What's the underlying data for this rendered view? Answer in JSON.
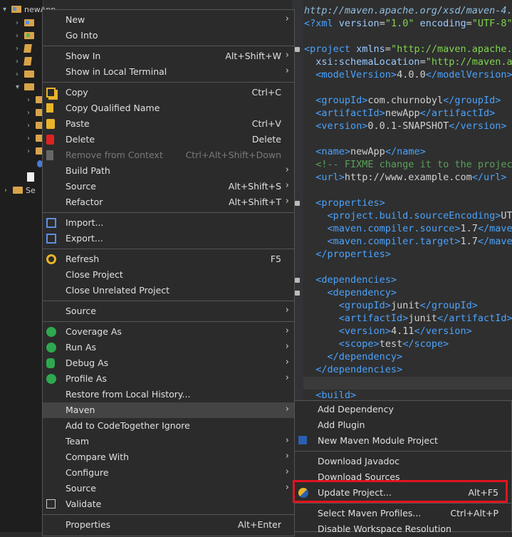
{
  "explorer": {
    "project_label": "newApp",
    "servers_label": "Se"
  },
  "editor": {
    "lines": [
      {
        "segs": [
          [
            "it",
            "http://maven.apache.org/xsd/maven-4.0"
          ]
        ]
      },
      {
        "segs": [
          [
            "tag",
            "<?xml "
          ],
          [
            "attr",
            "version"
          ],
          [
            "txt",
            "="
          ],
          [
            "str",
            "\"1.0\""
          ],
          [
            "txt",
            " "
          ],
          [
            "attr",
            "encoding"
          ],
          [
            "txt",
            "="
          ],
          [
            "str",
            "\"UTF-8\""
          ],
          [
            "tag",
            "?>"
          ]
        ]
      },
      {
        "segs": []
      },
      {
        "segs": [
          [
            "tag",
            "<project "
          ],
          [
            "attr",
            "xmlns"
          ],
          [
            "txt",
            "="
          ],
          [
            "str",
            "\"http://maven.apache.o"
          ]
        ]
      },
      {
        "segs": [
          [
            "txt",
            "  "
          ],
          [
            "attr",
            "xsi:schemaLocation"
          ],
          [
            "txt",
            "="
          ],
          [
            "str",
            "\"http://maven.ap"
          ]
        ]
      },
      {
        "segs": [
          [
            "txt",
            "  "
          ],
          [
            "tag",
            "<modelVersion>"
          ],
          [
            "txt",
            "4.0.0"
          ],
          [
            "tag",
            "</modelVersion>"
          ]
        ]
      },
      {
        "segs": []
      },
      {
        "segs": [
          [
            "txt",
            "  "
          ],
          [
            "tag",
            "<groupId>"
          ],
          [
            "txt",
            "com.churnobyl"
          ],
          [
            "tag",
            "</groupId>"
          ]
        ]
      },
      {
        "segs": [
          [
            "txt",
            "  "
          ],
          [
            "tag",
            "<artifactId>"
          ],
          [
            "txt",
            "newApp"
          ],
          [
            "tag",
            "</artifactId>"
          ]
        ]
      },
      {
        "segs": [
          [
            "txt",
            "  "
          ],
          [
            "tag",
            "<version>"
          ],
          [
            "txt",
            "0.0.1-SNAPSHOT"
          ],
          [
            "tag",
            "</version>"
          ]
        ]
      },
      {
        "segs": []
      },
      {
        "segs": [
          [
            "txt",
            "  "
          ],
          [
            "tag",
            "<name>"
          ],
          [
            "txt",
            "newApp"
          ],
          [
            "tag",
            "</name>"
          ]
        ]
      },
      {
        "segs": [
          [
            "txt",
            "  "
          ],
          [
            "cmt",
            "<!-- FIXME change it to the project"
          ]
        ]
      },
      {
        "segs": [
          [
            "txt",
            "  "
          ],
          [
            "tag",
            "<url>"
          ],
          [
            "txt",
            "http://www.example.com"
          ],
          [
            "tag",
            "</url>"
          ]
        ]
      },
      {
        "segs": []
      },
      {
        "segs": [
          [
            "txt",
            "  "
          ],
          [
            "tag",
            "<properties>"
          ]
        ]
      },
      {
        "segs": [
          [
            "txt",
            "    "
          ],
          [
            "tag",
            "<project.build.sourceEncoding>"
          ],
          [
            "txt",
            "UTF"
          ]
        ]
      },
      {
        "segs": [
          [
            "txt",
            "    "
          ],
          [
            "tag",
            "<maven.compiler.source>"
          ],
          [
            "txt",
            "1.7"
          ],
          [
            "tag",
            "</maven"
          ]
        ]
      },
      {
        "segs": [
          [
            "txt",
            "    "
          ],
          [
            "tag",
            "<maven.compiler.target>"
          ],
          [
            "txt",
            "1.7"
          ],
          [
            "tag",
            "</maven"
          ]
        ]
      },
      {
        "segs": [
          [
            "txt",
            "  "
          ],
          [
            "tag",
            "</properties>"
          ]
        ]
      },
      {
        "segs": []
      },
      {
        "segs": [
          [
            "txt",
            "  "
          ],
          [
            "tag",
            "<dependencies>"
          ]
        ]
      },
      {
        "segs": [
          [
            "txt",
            "    "
          ],
          [
            "tag",
            "<dependency>"
          ]
        ]
      },
      {
        "segs": [
          [
            "txt",
            "      "
          ],
          [
            "tag",
            "<groupId>"
          ],
          [
            "txt",
            "junit"
          ],
          [
            "tag",
            "</groupId>"
          ]
        ]
      },
      {
        "segs": [
          [
            "txt",
            "      "
          ],
          [
            "tag",
            "<artifactId>"
          ],
          [
            "txt",
            "junit"
          ],
          [
            "tag",
            "</artifactId>"
          ]
        ]
      },
      {
        "segs": [
          [
            "txt",
            "      "
          ],
          [
            "tag",
            "<version>"
          ],
          [
            "txt",
            "4.11"
          ],
          [
            "tag",
            "</version>"
          ]
        ]
      },
      {
        "segs": [
          [
            "txt",
            "      "
          ],
          [
            "tag",
            "<scope>"
          ],
          [
            "txt",
            "test"
          ],
          [
            "tag",
            "</scope>"
          ]
        ]
      },
      {
        "segs": [
          [
            "txt",
            "    "
          ],
          [
            "tag",
            "</dependency>"
          ]
        ]
      },
      {
        "segs": [
          [
            "txt",
            "  "
          ],
          [
            "tag",
            "</dependencies>"
          ]
        ]
      },
      {
        "segs": []
      },
      {
        "segs": [
          [
            "txt",
            "  "
          ],
          [
            "tag",
            "<build>"
          ]
        ]
      }
    ]
  },
  "menu": {
    "items": [
      {
        "label": "New",
        "submenu": true
      },
      {
        "label": "Go Into"
      },
      {
        "sep": true
      },
      {
        "label": "Show In",
        "shortcut": "Alt+Shift+W",
        "submenu": true
      },
      {
        "label": "Show in Local Terminal",
        "submenu": true
      },
      {
        "sep": true
      },
      {
        "label": "Copy",
        "shortcut": "Ctrl+C",
        "icon": "copy-icon"
      },
      {
        "label": "Copy Qualified Name",
        "icon": "copy-qualified-icon"
      },
      {
        "label": "Paste",
        "shortcut": "Ctrl+V",
        "icon": "paste-icon"
      },
      {
        "label": "Delete",
        "shortcut": "Delete",
        "icon": "delete-icon"
      },
      {
        "label": "Remove from Context",
        "shortcut": "Ctrl+Alt+Shift+Down",
        "icon": "remove-context-icon",
        "disabled": true
      },
      {
        "label": "Build Path",
        "submenu": true
      },
      {
        "label": "Source",
        "shortcut": "Alt+Shift+S",
        "submenu": true
      },
      {
        "label": "Refactor",
        "shortcut": "Alt+Shift+T",
        "submenu": true
      },
      {
        "sep": true
      },
      {
        "label": "Import...",
        "icon": "import-icon"
      },
      {
        "label": "Export...",
        "icon": "export-icon"
      },
      {
        "sep": true
      },
      {
        "label": "Refresh",
        "shortcut": "F5",
        "icon": "refresh-icon"
      },
      {
        "label": "Close Project"
      },
      {
        "label": "Close Unrelated Project"
      },
      {
        "sep": true
      },
      {
        "label": "Source",
        "submenu": true
      },
      {
        "sep": true
      },
      {
        "label": "Coverage As",
        "submenu": true,
        "icon": "coverage-icon"
      },
      {
        "label": "Run As",
        "submenu": true,
        "icon": "run-icon"
      },
      {
        "label": "Debug As",
        "submenu": true,
        "icon": "debug-icon"
      },
      {
        "label": "Profile As",
        "submenu": true,
        "icon": "profile-icon"
      },
      {
        "label": "Restore from Local History..."
      },
      {
        "label": "Maven",
        "submenu": true,
        "hot": true
      },
      {
        "label": "Add to CodeTogether Ignore"
      },
      {
        "label": "Team",
        "submenu": true
      },
      {
        "label": "Compare With",
        "submenu": true
      },
      {
        "label": "Configure",
        "submenu": true
      },
      {
        "label": "Source",
        "submenu": true
      },
      {
        "label": "Validate",
        "icon": "validate-icon"
      },
      {
        "sep": true
      },
      {
        "label": "Properties",
        "shortcut": "Alt+Enter"
      }
    ]
  },
  "maven_submenu": {
    "items": [
      {
        "label": "Add Dependency"
      },
      {
        "label": "Add Plugin"
      },
      {
        "label": "New Maven Module Project",
        "icon": "maven-module-icon"
      },
      {
        "sep": true
      },
      {
        "label": "Download Javadoc"
      },
      {
        "label": "Download Sources"
      },
      {
        "label": "Update Project...",
        "shortcut": "Alt+F5",
        "icon": "update-project-icon",
        "highlighted": true
      },
      {
        "sep": true
      },
      {
        "label": "Select Maven Profiles...",
        "shortcut": "Ctrl+Alt+P"
      },
      {
        "label": "Disable Workspace Resolution"
      }
    ]
  },
  "colors": {
    "highlight_box": "#e0141e",
    "menu_bg": "#2b2b2b",
    "tag": "#4aa3ff",
    "string": "#7fd44f"
  }
}
